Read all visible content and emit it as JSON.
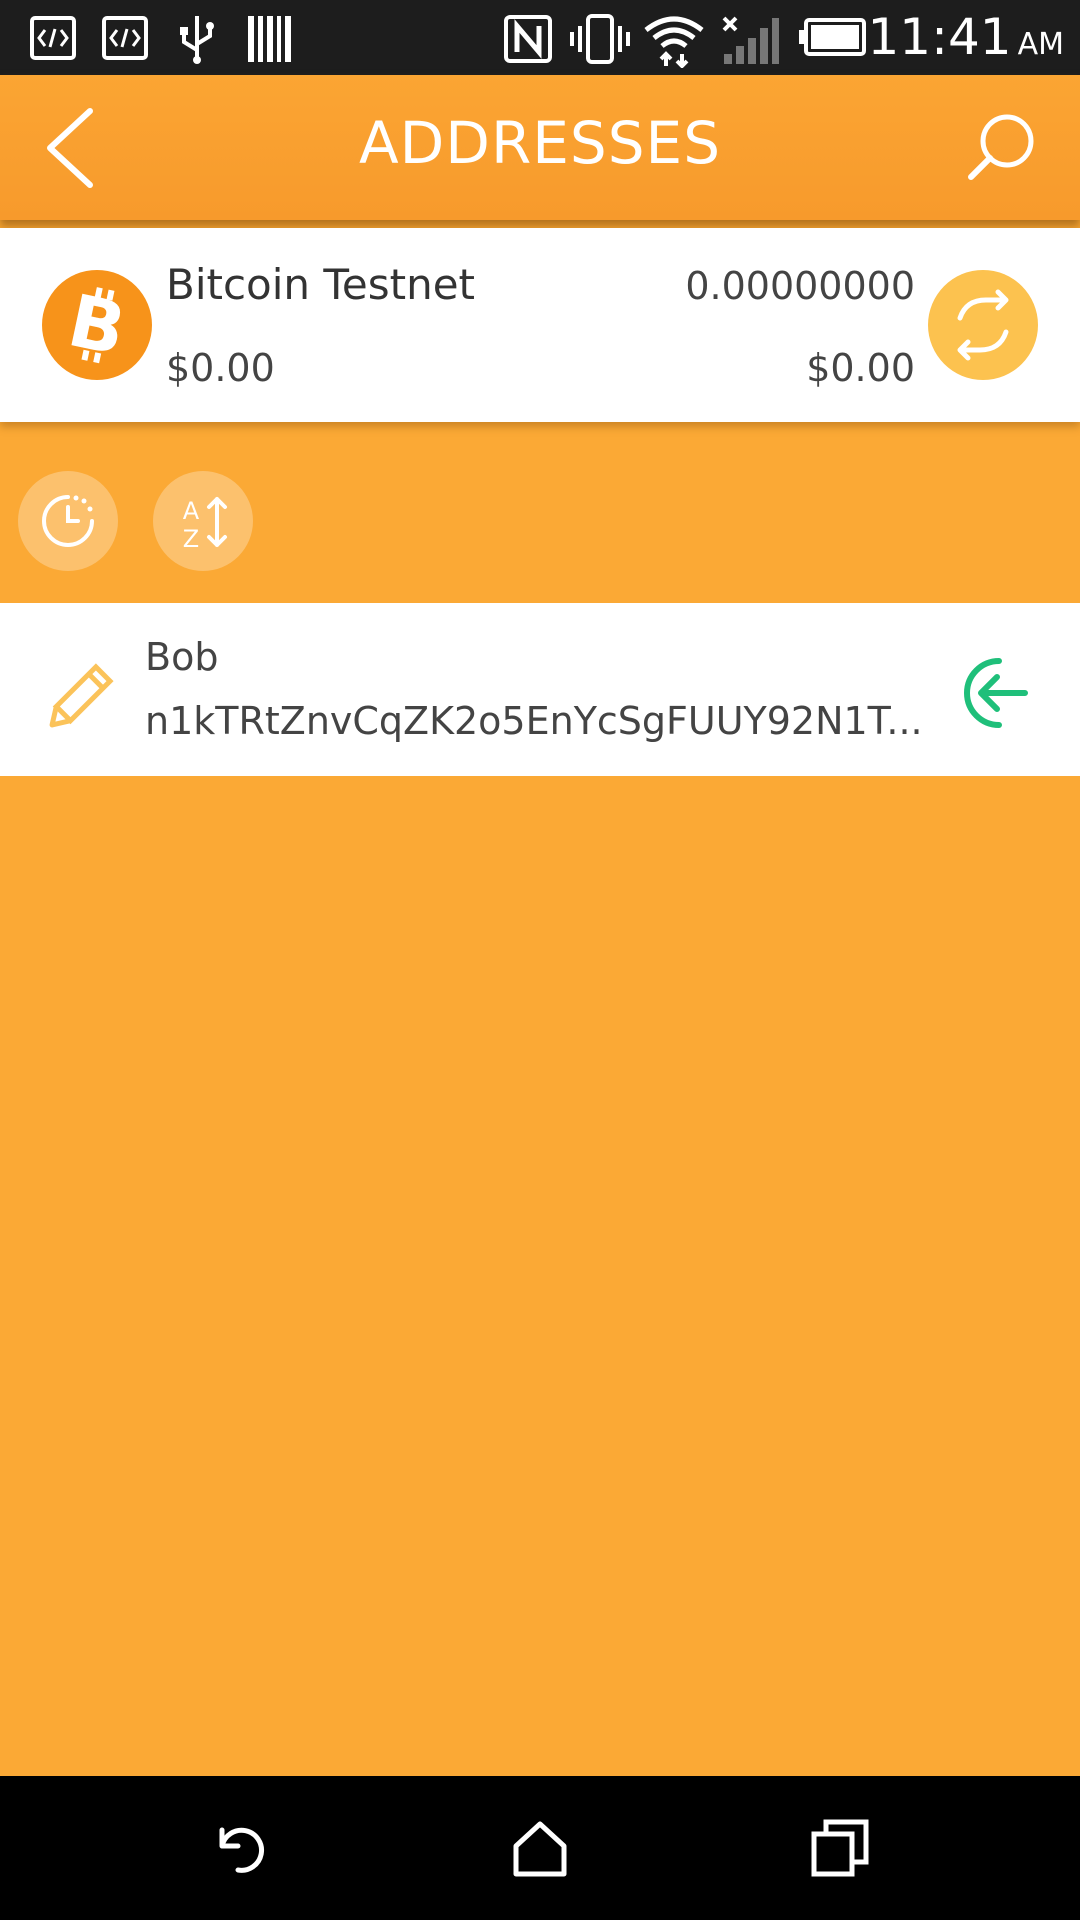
{
  "status_bar": {
    "time": "11:41",
    "ampm": "AM",
    "icons": [
      "code-icon",
      "code-icon",
      "usb-icon",
      "barcode-icon",
      "nfc-icon",
      "vibrate-icon",
      "wifi-icon",
      "signal-icon",
      "battery-icon"
    ]
  },
  "app_bar": {
    "title": "ADDRESSES",
    "back_icon": "chevron-left-icon",
    "search_icon": "search-icon"
  },
  "wallet": {
    "name": "Bitcoin Testnet",
    "fiat_value": "$0.00",
    "balance": "0.00000000",
    "balance_fiat": "$0.00",
    "logo_icon": "bitcoin-icon",
    "exchange_icon": "exchange-icon",
    "accent_color": "#f7931a"
  },
  "filters": [
    {
      "icon": "clock-icon"
    },
    {
      "icon": "sort-az-icon"
    }
  ],
  "addresses": [
    {
      "label": "Bob",
      "address": "n1kTRtZnvCqZK2o5EnYcSgFUUY92N1T...",
      "edit_icon": "pencil-icon",
      "action_icon": "receive-arrow-icon",
      "action_color": "#1fbf7a"
    }
  ],
  "nav_bar": {
    "back_icon": "back-icon",
    "home_icon": "home-icon",
    "recents_icon": "recents-icon"
  }
}
